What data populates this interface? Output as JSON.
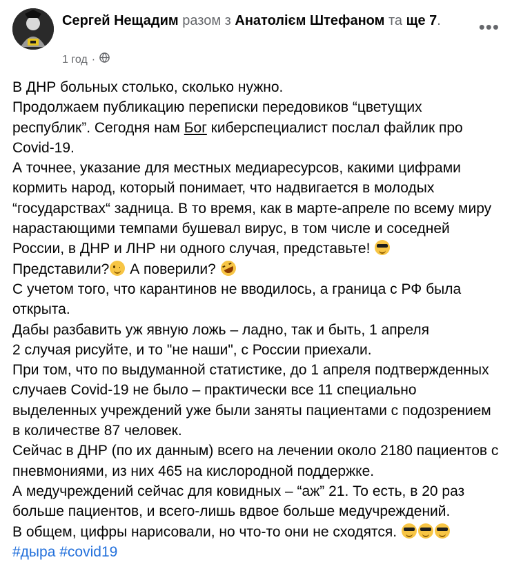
{
  "header": {
    "author": "Сергей Нещадим",
    "with_text": "разом з",
    "tagged": "Анатолієм Штефаном",
    "and_text": "та",
    "others": "ще 7",
    "period": ".",
    "time": "1 год",
    "dot": "·",
    "audience_icon": "globe-icon",
    "menu_label": "•••"
  },
  "post": {
    "l1": "В ДНР больных столько, сколько нужно.",
    "l2a": "Продолжаем публикацию переписки передовиков “цветущих республик”. Сегодня нам ",
    "l2_struck": "Бог",
    "l2b": " киберспециалист послал файлик про Covid-19.",
    "l3": "А точнее, указание для местных медиаресурсов, какими цифрами кормить народ, который понимает, что надвигается в молодых “государствах“ задница. В то время, как в марте-апреле по всему миру нарастающими темпами бушевал вирус, в том числе и соседней России, в ДНР и ЛНР ни одного случая, представьте!",
    "l4a": "Представили?",
    "l4b": " А поверили?",
    "l5": "С учетом того, что карантинов не вводилось, а граница с РФ была открыта.",
    "l6": "Дабы разбавить уж явную ложь – ладно, так и быть, 1 апреля",
    "l7": "2 случая рисуйте, и то \"не наши\", с России приехали.",
    "l8": "При том, что по выдуманной статистике, до 1 апреля подтвержденных случаев Covid-19 не было – практически все 11 специально выделенных учреждений уже были заняты пациентами с подозрением в количестве 87 человек.",
    "l9": "Сейчас в ДНР (по их данным) всего на лечении около 2180 пациентов с пневмониями, из них 465 на кислородной поддержке.",
    "l10": "А медучреждений сейчас для ковидных – “аж” 21. То есть, в 20 раз больше пациентов, и всего-лишь вдвое больше медучреждений.",
    "l11": "В общем, цифры нарисовали, но что-то они не сходятся.",
    "hashtags": [
      "#дыра",
      "#covid19"
    ]
  },
  "emoji_names": [
    "smiling-face-with-sunglasses-icon",
    "winking-face-icon",
    "rolling-on-the-floor-laughing-icon"
  ],
  "colors": {
    "link": "#216fdb",
    "muted": "#65676b",
    "text": "#050505"
  }
}
